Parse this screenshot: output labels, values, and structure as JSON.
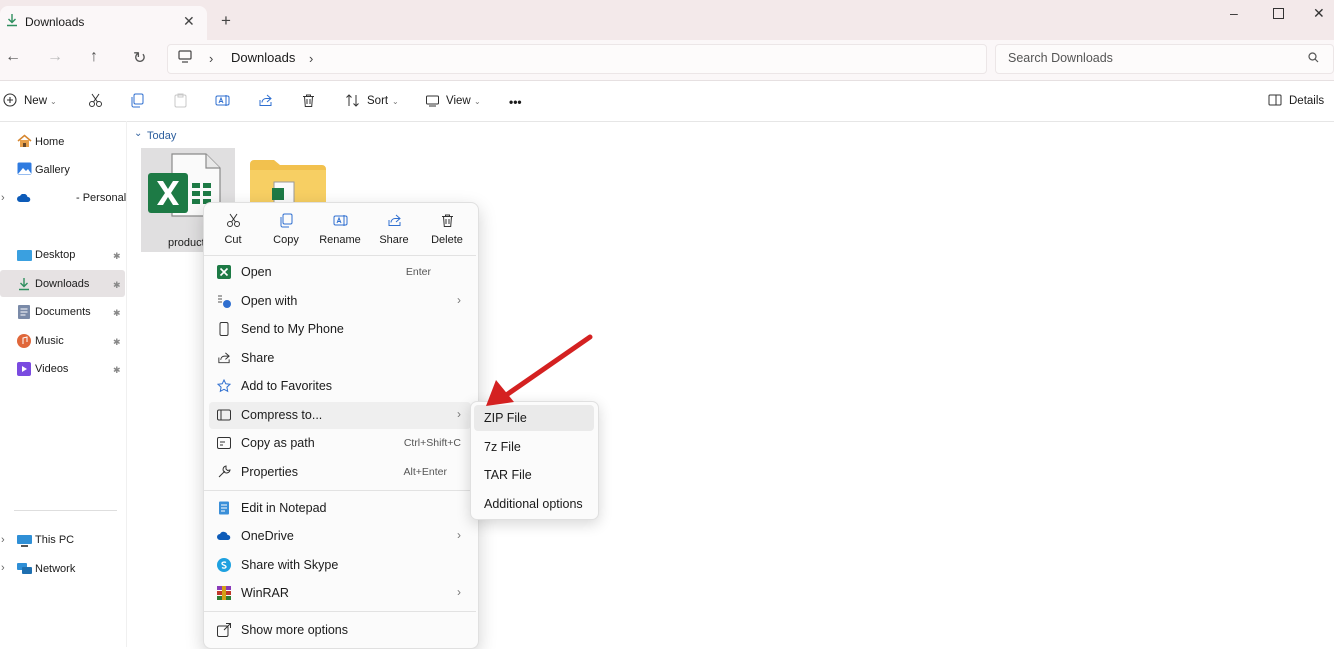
{
  "window": {
    "tab_title": "Downloads",
    "tab_close": "✕",
    "new_tab": "+",
    "minimize": "–",
    "close": "✕"
  },
  "address": {
    "back": "←",
    "forward": "→",
    "up": "↑",
    "refresh": "↻",
    "sep1": "›",
    "crumb": "Downloads",
    "sep2": "›",
    "search_placeholder": "Search Downloads"
  },
  "commandbar": {
    "new": "New",
    "sort": "Sort",
    "view": "View",
    "more": "•••",
    "details": "Details",
    "caret": "⌄"
  },
  "sidebar": {
    "expand": "›",
    "pin": "✱",
    "top_items": [
      {
        "label": "Home",
        "icon": "home-icon"
      },
      {
        "label": "Gallery",
        "icon": "gallery-icon"
      },
      {
        "label": "- Personal",
        "icon": "onedrive-icon"
      }
    ],
    "quick_access": [
      {
        "label": "Desktop",
        "icon": "desktop-icon",
        "color": "#3aa0e0"
      },
      {
        "label": "Downloads",
        "icon": "download-icon",
        "color": "#2f8f5f",
        "selected": true
      },
      {
        "label": "Documents",
        "icon": "documents-icon",
        "color": "#7a8aa8"
      },
      {
        "label": "Music",
        "icon": "music-icon",
        "color": "#e0673a"
      },
      {
        "label": "Videos",
        "icon": "videos-icon",
        "color": "#7a4be0"
      }
    ],
    "bottom_items": [
      {
        "label": "This PC",
        "icon": "pc-icon"
      },
      {
        "label": "Network",
        "icon": "network-icon"
      }
    ]
  },
  "content": {
    "group_label": "Today",
    "group_chevron": "⌄",
    "file_name": "product"
  },
  "context_menu": {
    "quick_actions": [
      {
        "label": "Cut",
        "icon": "scissors-icon"
      },
      {
        "label": "Copy",
        "icon": "copy-icon"
      },
      {
        "label": "Rename",
        "icon": "rename-icon"
      },
      {
        "label": "Share",
        "icon": "share-icon"
      },
      {
        "label": "Delete",
        "icon": "trash-icon"
      }
    ],
    "items": [
      {
        "label": "Open",
        "shortcut": "Enter",
        "icon": "excel-icon"
      },
      {
        "label": "Open with",
        "submenu": true,
        "icon": "open-with-icon"
      },
      {
        "label": "Send to My Phone",
        "icon": "phone-icon"
      },
      {
        "label": "Share",
        "icon": "share-icon"
      },
      {
        "label": "Add to Favorites",
        "icon": "star-icon"
      },
      {
        "label": "Compress to...",
        "submenu": true,
        "icon": "compress-icon",
        "highlighted": true
      },
      {
        "label": "Copy as path",
        "shortcut": "Ctrl+Shift+C",
        "icon": "copy-path-icon"
      },
      {
        "label": "Properties",
        "shortcut": "Alt+Enter",
        "icon": "wrench-icon"
      },
      {
        "label": "Edit in Notepad",
        "icon": "notepad-icon"
      },
      {
        "label": "OneDrive",
        "submenu": true,
        "icon": "onedrive-icon"
      },
      {
        "label": "Share with Skype",
        "icon": "skype-icon"
      },
      {
        "label": "WinRAR",
        "submenu": true,
        "icon": "winrar-icon"
      },
      {
        "label": "Show more options",
        "icon": "more-options-icon"
      }
    ],
    "chevron": "›"
  },
  "submenu": {
    "items": [
      "ZIP File",
      "7z File",
      "TAR File",
      "Additional options"
    ]
  },
  "colors": {
    "annotation_arrow": "#d42121",
    "excel_green": "#1d7a45",
    "folder_yellow": "#f2c14e"
  }
}
